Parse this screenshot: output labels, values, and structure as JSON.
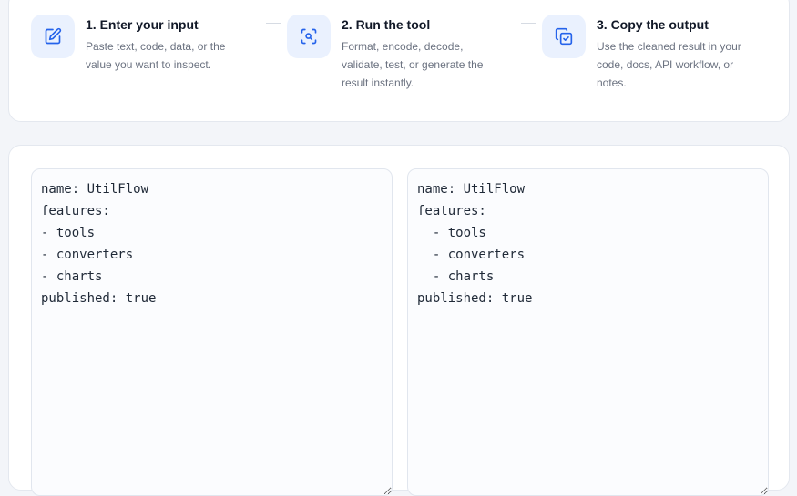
{
  "steps": [
    {
      "title": "1. Enter your input",
      "description": "Paste text, code, data, or the value you want to inspect.",
      "icon": "edit-icon"
    },
    {
      "title": "2. Run the tool",
      "description": "Format, encode, decode, validate, test, or generate the result instantly.",
      "icon": "scan-search-icon"
    },
    {
      "title": "3. Copy the output",
      "description": "Use the cleaned result in your code, docs, API workflow, or notes.",
      "icon": "copy-check-icon"
    }
  ],
  "editor": {
    "input_text": "name: UtilFlow\nfeatures:\n- tools\n- converters\n- charts\npublished: true",
    "output_text": "name: UtilFlow\nfeatures:\n  - tools\n  - converters\n  - charts\npublished: true"
  },
  "colors": {
    "accent": "#2563eb",
    "icon_bg": "#eaf1fe",
    "page_bg": "#f3f5f9",
    "title": "#111827",
    "muted": "#6b7280"
  }
}
